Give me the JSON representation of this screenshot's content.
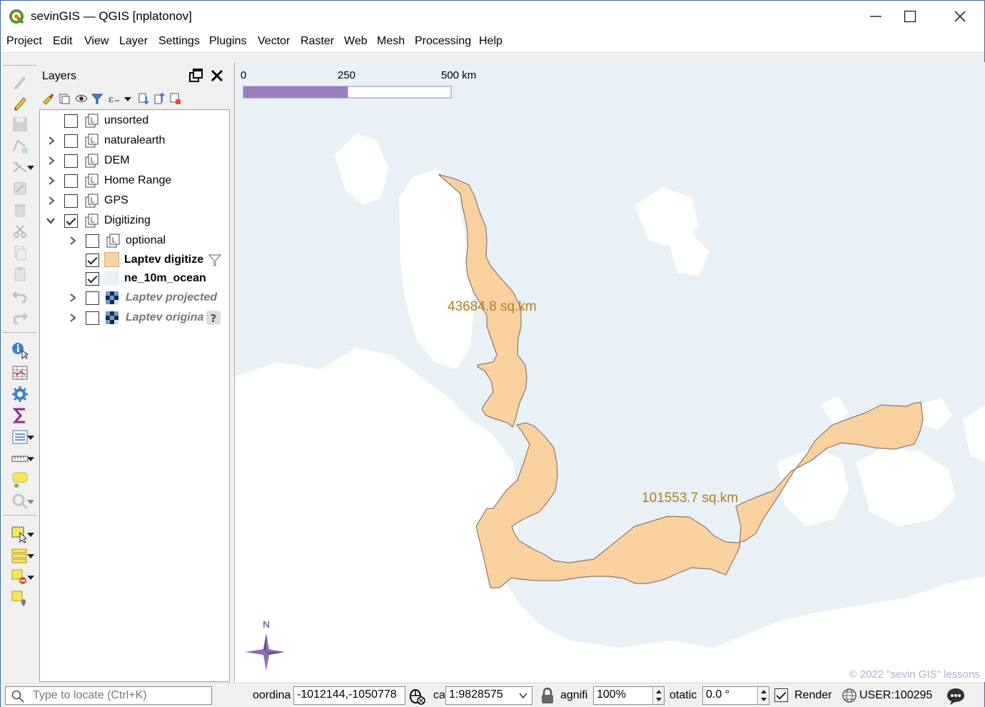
{
  "window": {
    "title": "sevinGIS — QGIS [nplatonov]"
  },
  "menu": [
    "Project",
    "Edit",
    "View",
    "Layer",
    "Settings",
    "Plugins",
    "Vector",
    "Raster",
    "Web",
    "Mesh",
    "Processing",
    "Help"
  ],
  "layers_panel": {
    "title": "Layers",
    "items": [
      {
        "label": "unsorted",
        "checked": false,
        "type": "group",
        "level": 0,
        "expandable": false
      },
      {
        "label": "naturalearth",
        "checked": false,
        "type": "group",
        "level": 0,
        "expandable": true
      },
      {
        "label": "DEM",
        "checked": false,
        "type": "group",
        "level": 0,
        "expandable": true
      },
      {
        "label": "Home Range",
        "checked": false,
        "type": "group",
        "level": 0,
        "expandable": true
      },
      {
        "label": "GPS",
        "checked": false,
        "type": "group",
        "level": 0,
        "expandable": true
      },
      {
        "label": "Digitizing",
        "checked": true,
        "type": "group",
        "level": 0,
        "expandable": true,
        "expanded": true
      },
      {
        "label": "optional",
        "checked": false,
        "type": "group",
        "level": 1,
        "expandable": true
      },
      {
        "label": "Laptev digitize",
        "checked": true,
        "type": "polygon",
        "level": 1,
        "bold": true,
        "fill": "#f9d19f",
        "badge": "filter-icon"
      },
      {
        "label": "ne_10m_ocean",
        "checked": true,
        "type": "polygon",
        "level": 1,
        "bold": true,
        "fill": "#e9f1f7"
      },
      {
        "label": "Laptev projected",
        "checked": false,
        "type": "raster",
        "level": 1,
        "italic": true,
        "expandable": true
      },
      {
        "label": "Laptev origina",
        "checked": false,
        "type": "raster",
        "level": 1,
        "italic": true,
        "expandable": true,
        "badge": "help-icon"
      }
    ]
  },
  "map": {
    "scalebar": {
      "labels": [
        "0",
        "250",
        "500 km"
      ],
      "color": "#9b7fbd"
    },
    "labels": [
      "43684.8 sq.km",
      "101553.7 sq.km"
    ],
    "label_color": "#b47c21",
    "polygon_fill": "#f9d19f",
    "water_color": "#e9f1f7",
    "north_label": "N",
    "north_color": "#8e6fb0",
    "copyright": "© 2022 \"sevin GIS\" lessons"
  },
  "statusbar": {
    "locate_placeholder": "Type to locate (Ctrl+K)",
    "coordinate_label": "oordina",
    "coordinate_value": "-1012144,-1050778",
    "scale_label": "ca",
    "scale_value": "1:9828575",
    "magnifier_label": "agnifi",
    "magnifier_value": "100%",
    "rotation_label": "otatic",
    "rotation_value": "0.0 °",
    "render_label": "Render",
    "render_checked": true,
    "crs": "USER:100295"
  }
}
